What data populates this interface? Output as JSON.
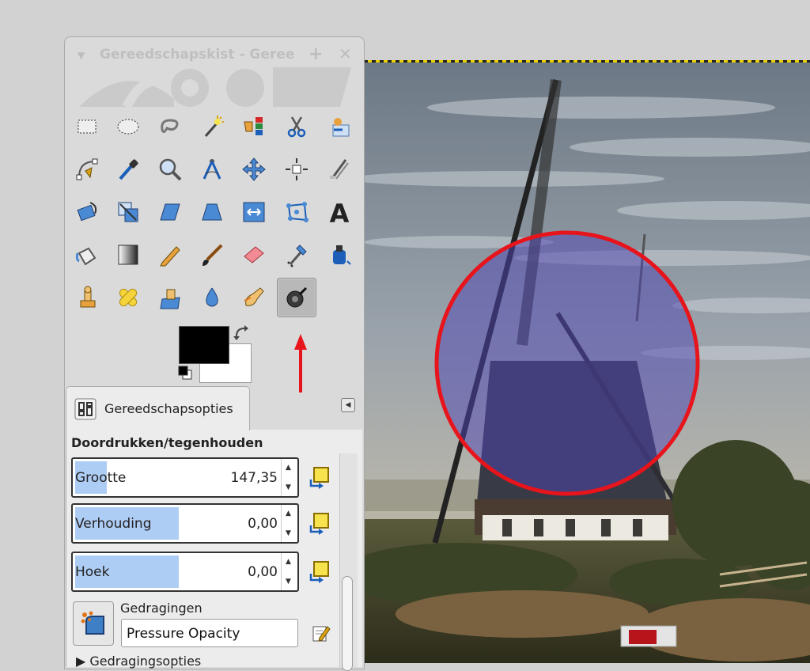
{
  "window": {
    "title": "Gereedschapskist - Geree",
    "pin_glyph": "+",
    "close_glyph": "✕"
  },
  "tools": [
    {
      "icon": "rectangle-select-icon"
    },
    {
      "icon": "ellipse-select-icon"
    },
    {
      "icon": "free-select-icon"
    },
    {
      "icon": "fuzzy-select-icon"
    },
    {
      "icon": "select-by-color-icon"
    },
    {
      "icon": "scissors-select-icon"
    },
    {
      "icon": "foreground-select-icon"
    },
    {
      "icon": "paths-icon"
    },
    {
      "icon": "color-picker-icon"
    },
    {
      "icon": "zoom-icon"
    },
    {
      "icon": "measure-icon"
    },
    {
      "icon": "move-icon"
    },
    {
      "icon": "align-icon"
    },
    {
      "icon": "crop-icon"
    },
    {
      "icon": "rotate-icon"
    },
    {
      "icon": "scale-icon"
    },
    {
      "icon": "shear-icon"
    },
    {
      "icon": "perspective-icon"
    },
    {
      "icon": "flip-icon"
    },
    {
      "icon": "cage-transform-icon"
    },
    {
      "icon": "text-icon"
    },
    {
      "icon": "bucket-fill-icon"
    },
    {
      "icon": "blend-icon"
    },
    {
      "icon": "pencil-icon"
    },
    {
      "icon": "paintbrush-icon"
    },
    {
      "icon": "eraser-icon"
    },
    {
      "icon": "airbrush-icon"
    },
    {
      "icon": "ink-icon"
    },
    {
      "icon": "clone-icon"
    },
    {
      "icon": "heal-icon"
    },
    {
      "icon": "perspective-clone-icon"
    },
    {
      "icon": "blur-sharpen-icon"
    },
    {
      "icon": "smudge-icon"
    },
    {
      "icon": "dodge-burn-icon",
      "active": true
    }
  ],
  "colors": {
    "foreground": "#000000",
    "background": "#ffffff",
    "annotation_red": "#e8141c",
    "highlight_fill": "#4d44b4"
  },
  "tool_options": {
    "tab_label": "Gereedschapsopties",
    "section_title": "Doordrukken/tegenhouden",
    "fields": [
      {
        "label": "Grootte",
        "value": "147,35",
        "fill_fraction": 0.14
      },
      {
        "label": "Verhouding",
        "value": "0,00",
        "fill_fraction": 0.46
      },
      {
        "label": "Hoek",
        "value": "0,00",
        "fill_fraction": 0.46
      }
    ],
    "dynamics_label": "Gedragingen",
    "dynamics_value": "Pressure Opacity",
    "dynamics_options_label": "Gedragingsopties"
  }
}
